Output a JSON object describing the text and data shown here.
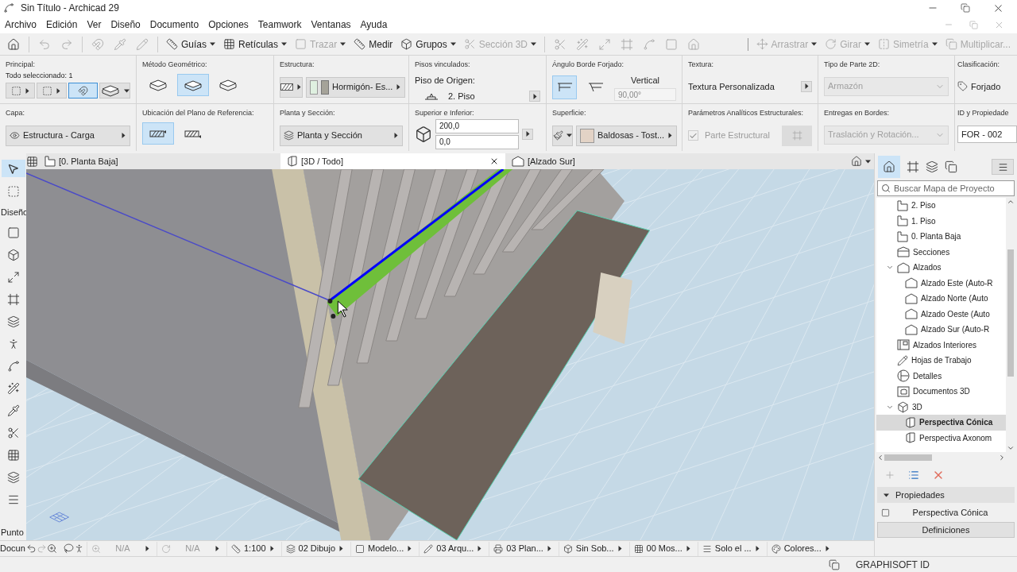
{
  "window": {
    "title": "Sin Título - Archicad 29"
  },
  "menu": [
    "Archivo",
    "Edición",
    "Ver",
    "Diseño",
    "Documento",
    "Opciones",
    "Teamwork",
    "Ventanas",
    "Ayuda"
  ],
  "toolbar": [
    {
      "label": "Guías",
      "dropdown": true,
      "disabled": false
    },
    {
      "label": "Retículas",
      "dropdown": true,
      "disabled": false
    },
    {
      "label": "Trazar",
      "dropdown": true,
      "disabled": true
    },
    {
      "label": "Medir",
      "dropdown": false,
      "disabled": false
    },
    {
      "label": "Grupos",
      "dropdown": true,
      "disabled": false
    },
    {
      "label": "Sección 3D",
      "dropdown": true,
      "disabled": true
    },
    {
      "label": "Arrastrar",
      "dropdown": true,
      "disabled": true
    },
    {
      "label": "Girar",
      "dropdown": true,
      "disabled": true
    },
    {
      "label": "Simetría",
      "dropdown": true,
      "disabled": true
    },
    {
      "label": "Multiplicar...",
      "dropdown": false,
      "disabled": true
    }
  ],
  "info_top": [
    {
      "kind": "selection",
      "title": "Principal:",
      "text": "Todo seleccionado: 1",
      "options": [
        {
          "selected": false
        },
        {
          "selected": false
        },
        {
          "selected": true
        }
      ]
    },
    {
      "kind": "geometry",
      "title": "Método Geométrico:",
      "options": [
        {
          "selected": false
        },
        {
          "selected": true
        },
        {
          "selected": false
        }
      ]
    },
    {
      "kind": "structure",
      "title": "Estructura:",
      "value": "Hormigón- Es..."
    },
    {
      "kind": "story",
      "title": "Pisos vinculados:",
      "label": "Piso de Origen:",
      "value": "2. Piso"
    },
    {
      "kind": "angle",
      "title": "Ángulo Borde Forjado:",
      "options": [
        {
          "selected": true
        },
        {
          "selected": false
        }
      ],
      "label": "Vertical",
      "value": "90,00°"
    },
    {
      "kind": "popup",
      "title": "Textura:",
      "value": "Textura Personalizada"
    },
    {
      "kind": "dropdown",
      "title": "Tipo de Parte 2D:",
      "value": "Armazón",
      "disabled": true
    },
    {
      "kind": "classification",
      "title": "Clasificación:",
      "value": "Forjado"
    }
  ],
  "info_bottom": [
    {
      "kind": "layer",
      "title": "Capa:",
      "value": "Estructura - Carga"
    },
    {
      "kind": "reference",
      "title": "Ubicación del Plano de Referencia:",
      "options": [
        {
          "selected": true
        },
        {
          "selected": false
        }
      ]
    },
    {
      "kind": "section",
      "title": "Planta y Sección:",
      "value": "Planta y Sección"
    },
    {
      "kind": "offsets",
      "title": "Superior e Inferior:",
      "values": [
        "200,0",
        "0,0"
      ]
    },
    {
      "kind": "surface",
      "title": "Superficie:",
      "value": "Baldosas - Tost...",
      "color": "#e3d3c6"
    },
    {
      "kind": "checkbox",
      "title": "Parámetros Analíticos Estructurales:",
      "label": "Parte Estructural",
      "checked": true,
      "disabled": true
    },
    {
      "kind": "dropdown",
      "title": "Entregas en Bordes:",
      "value": "Traslación y Rotación...",
      "disabled": true
    },
    {
      "kind": "field",
      "title": "ID y Propiedade",
      "value": "FOR - 002"
    }
  ],
  "tabs": [
    {
      "label": "[0. Planta Baja]",
      "selected": false,
      "closable": false
    },
    {
      "label": "[3D / Todo]",
      "selected": true,
      "closable": true
    },
    {
      "label": "[Alzado Sur]",
      "selected": false,
      "closable": false
    }
  ],
  "toolbox": {
    "section_labels": [
      "Diseño",
      "Punto"
    ]
  },
  "navigator": {
    "search_placeholder": "Buscar Mapa de Proyecto",
    "tree": [
      {
        "children": [
          {
            "label": "2. Piso",
            "kind": "story",
            "selected": false
          },
          {
            "label": "1. Piso",
            "kind": "story",
            "selected": false
          },
          {
            "label": "0. Planta Baja",
            "kind": "story",
            "selected": false
          }
        ]
      },
      {
        "label": "Secciones",
        "kind": "section",
        "selected": false
      },
      {
        "label": "Alzados",
        "kind": "elevation",
        "selected": false,
        "expanded": true,
        "children": [
          {
            "label": "Alzado Este (Auto-R",
            "kind": "elevation",
            "selected": false
          },
          {
            "label": "Alzado Norte (Auto",
            "kind": "elevation",
            "selected": false
          },
          {
            "label": "Alzado Oeste (Auto",
            "kind": "elevation",
            "selected": false
          },
          {
            "label": "Alzado Sur (Auto-R",
            "kind": "elevation",
            "selected": false
          }
        ]
      },
      {
        "label": "Alzados Interiores",
        "kind": "interior",
        "selected": false
      },
      {
        "label": "Hojas de Trabajo",
        "kind": "worksheet",
        "selected": false
      },
      {
        "label": "Detalles",
        "kind": "detail",
        "selected": false
      },
      {
        "label": "Documentos 3D",
        "kind": "doc3d",
        "selected": false
      },
      {
        "label": "3D",
        "kind": "folder3d",
        "selected": false,
        "expanded": true,
        "children": [
          {
            "label": "Perspectiva Cónica",
            "kind": "view3d",
            "selected": true
          },
          {
            "label": "Perspectiva Axonom",
            "kind": "view3d",
            "selected": false
          }
        ]
      }
    ]
  },
  "properties": {
    "title": "Propiedades",
    "expanded": true,
    "item": "Perspectiva Cónica",
    "button": "Definiciones"
  },
  "status_bar": {
    "label": "Docun",
    "items": [
      {
        "label": "N/A",
        "disabled": true
      },
      {
        "label": "N/A",
        "disabled": true
      },
      {
        "label": "1:100",
        "disabled": false
      },
      {
        "label": "02 Dibujo",
        "disabled": false
      },
      {
        "label": "Modelo...",
        "disabled": false
      },
      {
        "label": "03 Arqu...",
        "disabled": false
      },
      {
        "label": "03 Plan...",
        "disabled": false
      },
      {
        "label": "Sin Sob...",
        "disabled": false
      },
      {
        "label": "00 Mos...",
        "disabled": false
      },
      {
        "label": "Solo el ...",
        "disabled": false
      },
      {
        "label": "Colores...",
        "disabled": false
      }
    ]
  },
  "footer": {
    "brand": "GRAPHISOFT ID"
  }
}
